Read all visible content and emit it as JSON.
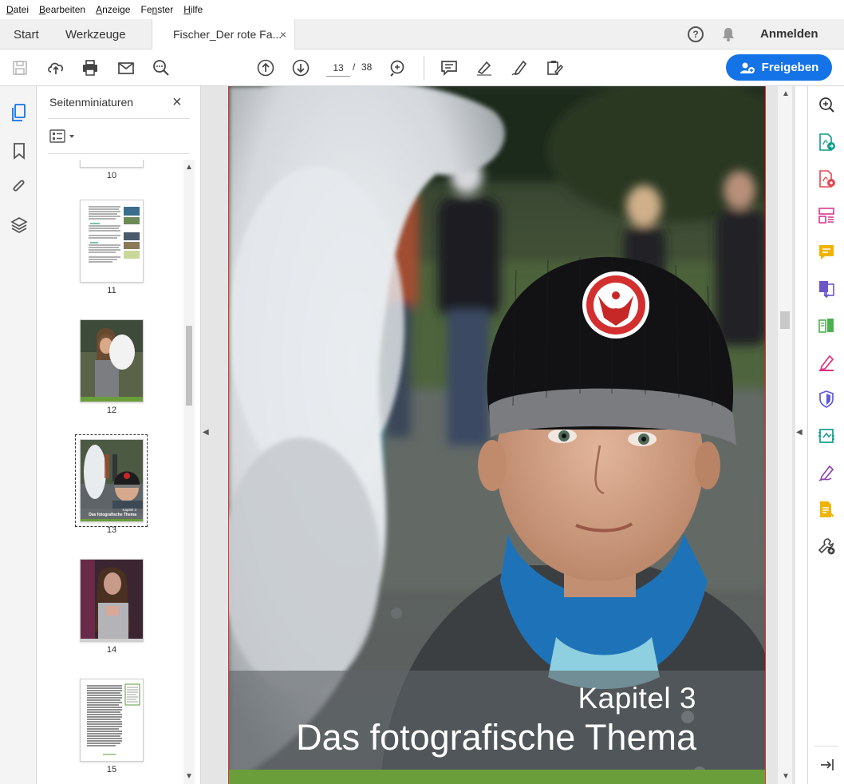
{
  "menu": {
    "items": [
      {
        "label": "Datei",
        "key": "D"
      },
      {
        "label": "Bearbeiten",
        "key": "B"
      },
      {
        "label": "Anzeige",
        "key": "A"
      },
      {
        "label": "Fenster",
        "key": "n"
      },
      {
        "label": "Hilfe",
        "key": "H"
      }
    ]
  },
  "tabs": {
    "start": "Start",
    "tools": "Werkzeuge",
    "doc": "Fischer_Der rote Fa...",
    "doc_close": "×"
  },
  "header": {
    "help_glyph": "?",
    "signin": "Anmelden"
  },
  "toolbar": {
    "page_current": "13",
    "page_sep": "/",
    "page_total": "38",
    "share_label": "Freigeben",
    "accent": "#1473e6"
  },
  "panel": {
    "title": "Seitenminiaturen",
    "close": "×",
    "thumbnails": [
      {
        "page": "10"
      },
      {
        "page": "11"
      },
      {
        "page": "12"
      },
      {
        "page": "13"
      },
      {
        "page": "14"
      },
      {
        "page": "15"
      }
    ],
    "selected_page": "13",
    "thumb13_label": "Kapitel 3",
    "thumb13_title": "Das fotografische Thema"
  },
  "document": {
    "chapter_label": "Kapitel 3",
    "chapter_title": "Das fotografische Thema",
    "green": "#6a9e3a"
  }
}
